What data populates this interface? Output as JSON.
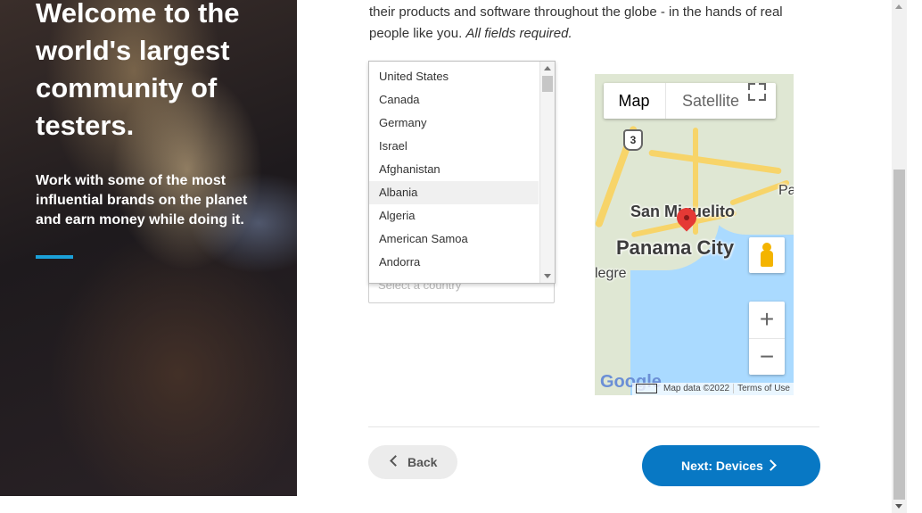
{
  "hero": {
    "title": "Welcome to the world's largest community of testers.",
    "subtitle": "Work with some of the most influential brands on the planet and earn money while doing it.",
    "accent_color": "#1ba0d8"
  },
  "intro": {
    "text": "their products and software throughout the globe - in the hands of real people like you.",
    "required_note": "All fields required."
  },
  "country_select": {
    "placeholder": "Select a country",
    "options": [
      "United States",
      "Canada",
      "Germany",
      "Israel",
      "Afghanistan",
      "Albania",
      "Algeria",
      "American Samoa",
      "Andorra"
    ],
    "highlighted": "Albania"
  },
  "map": {
    "tab_map": "Map",
    "tab_satellite": "Satellite",
    "route_number": "3",
    "labels": {
      "san_miguelito": "San Miguelito",
      "panama_city": "Panama City",
      "pa": "Pa",
      "alegre": "legre"
    },
    "zoom_in": "+",
    "zoom_out": "−",
    "google": "Google",
    "map_data": "Map data ©2022",
    "terms": "Terms of Use"
  },
  "nav": {
    "back_label": "Back",
    "next_label": "Next: Devices",
    "next_color": "#0878c4"
  }
}
